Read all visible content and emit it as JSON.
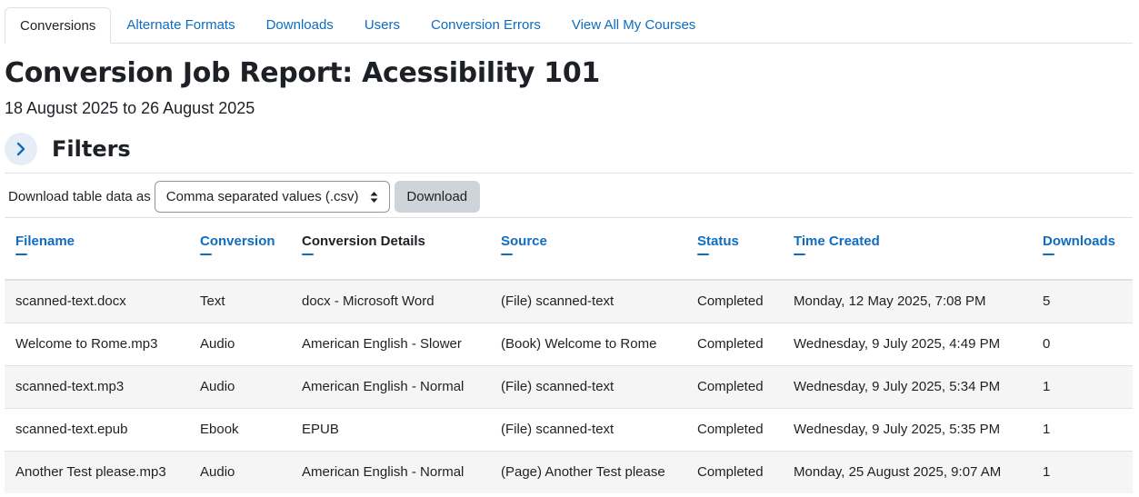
{
  "tabs": [
    {
      "label": "Conversions",
      "active": true
    },
    {
      "label": "Alternate Formats",
      "active": false
    },
    {
      "label": "Downloads",
      "active": false
    },
    {
      "label": "Users",
      "active": false
    },
    {
      "label": "Conversion Errors",
      "active": false
    },
    {
      "label": "View All My Courses",
      "active": false
    }
  ],
  "page": {
    "title": "Conversion Job Report: Acessibility 101",
    "date_range": "18 August 2025 to 26 August 2025"
  },
  "filters": {
    "label": "Filters",
    "toggle_icon": "chevron-right-icon"
  },
  "download": {
    "label": "Download table data as",
    "selected_format": "Comma separated values (.csv)",
    "button_label": "Download"
  },
  "table": {
    "headers": [
      "Filename",
      "Conversion",
      "Conversion Details",
      "Source",
      "Status",
      "Time Created",
      "Downloads"
    ],
    "rows": [
      [
        "scanned-text.docx",
        "Text",
        "docx - Microsoft Word",
        "(File) scanned-text",
        "Completed",
        "Monday, 12 May 2025, 7:08 PM",
        "5"
      ],
      [
        "Welcome to Rome.mp3",
        "Audio",
        "American English - Slower",
        "(Book) Welcome to Rome",
        "Completed",
        "Wednesday, 9 July 2025, 4:49 PM",
        "0"
      ],
      [
        "scanned-text.mp3",
        "Audio",
        "American English - Normal",
        "(File) scanned-text",
        "Completed",
        "Wednesday, 9 July 2025, 5:34 PM",
        "1"
      ],
      [
        "scanned-text.epub",
        "Ebook",
        "EPUB",
        "(File) scanned-text",
        "Completed",
        "Wednesday, 9 July 2025, 5:35 PM",
        "1"
      ],
      [
        "Another Test please.mp3",
        "Audio",
        "American English - Normal",
        "(Page) Another Test please",
        "Completed",
        "Monday, 25 August 2025, 9:07 AM",
        "1"
      ]
    ]
  },
  "colors": {
    "link": "#0f6cbf",
    "text": "#1d2125",
    "stripe": "#f5f5f5",
    "button_bg": "#ced4da"
  }
}
